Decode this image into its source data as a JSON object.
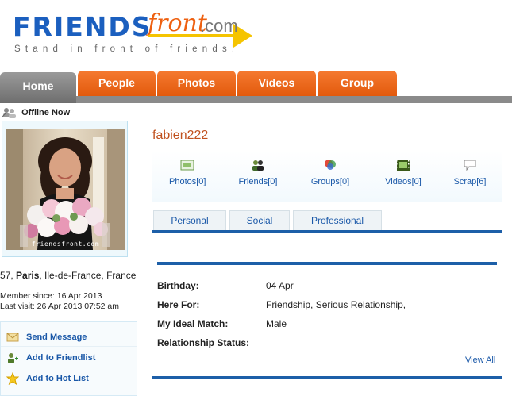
{
  "logo": {
    "main": "FRIENDS",
    "front": "front",
    "com": ".com",
    "tagline": "Stand in front of friends!"
  },
  "nav": {
    "tabs": [
      "Home",
      "People",
      "Photos",
      "Videos",
      "Group"
    ],
    "active": "Home"
  },
  "status": {
    "label": "Offline Now"
  },
  "photo": {
    "watermark": "friendsfront.com"
  },
  "location": {
    "prefix": "57, ",
    "city": "Paris",
    "rest": ", Ile-de-France, France"
  },
  "member": {
    "since": "Member since: 16 Apr 2013",
    "last_visit": "Last visit: 26 Apr 2013 07:52 am"
  },
  "actions": [
    {
      "label": "Send Message",
      "icon": "envelope-icon"
    },
    {
      "label": "Add to Friendlist",
      "icon": "add-friend-icon"
    },
    {
      "label": "Add to Hot List",
      "icon": "star-icon"
    }
  ],
  "profile": {
    "username": "fabien222",
    "quicklinks": [
      {
        "label": "Photos[0]",
        "icon": "photo-icon"
      },
      {
        "label": "Friends[0]",
        "icon": "friends-icon"
      },
      {
        "label": "Groups[0]",
        "icon": "groups-icon"
      },
      {
        "label": "Videos[0]",
        "icon": "film-icon"
      },
      {
        "label": "Scrap[6]",
        "icon": "speech-bubble-icon"
      }
    ],
    "tabs": [
      "Personal",
      "Social",
      "Professional"
    ],
    "fields": [
      {
        "key": "Birthday:",
        "value": "04 Apr"
      },
      {
        "key": "Here For:",
        "value": "Friendship, Serious Relationship,"
      },
      {
        "key": "My Ideal Match:",
        "value": "Male"
      },
      {
        "key": "Relationship Status:",
        "value": ""
      }
    ],
    "view_all": "View All"
  },
  "colors": {
    "brand_blue": "#1b5fbf",
    "brand_orange": "#ee6010",
    "tab_orange": "#e8661a",
    "link_blue": "#1a58a8",
    "rule_blue": "#1d5fa8"
  }
}
